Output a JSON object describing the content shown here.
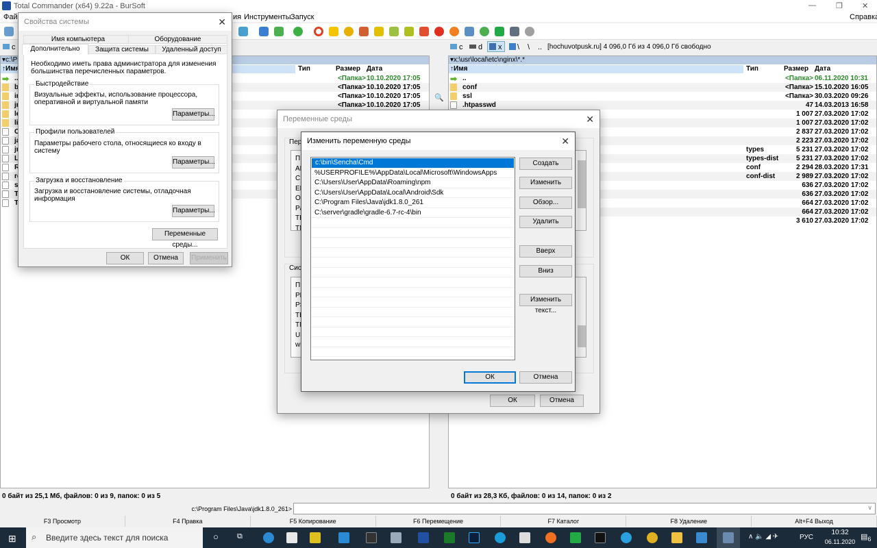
{
  "window": {
    "title": "Total Commander (x64) 9.22a - BurSoft",
    "min": "—",
    "max": "❐",
    "close": "✕"
  },
  "menu": {
    "file": "Фай",
    "frag": "ия",
    "tools": "Инструменты",
    "launch": "Запуск",
    "help": "Справка"
  },
  "left": {
    "drive": "c",
    "path": "▾c:\\Pr",
    "col_name": "↑Имя",
    "col_type": "Тип",
    "col_size": "Размер",
    "col_date": "Дата",
    "rows": [
      {
        "n": "..",
        "t": "",
        "s": "<Папка>",
        "d": "10.10.2020 17:05",
        "i": "up"
      },
      {
        "n": "bi",
        "t": "",
        "s": "<Папка>",
        "d": "10.10.2020 17:05",
        "i": "folder"
      },
      {
        "n": "in",
        "t": "",
        "s": "<Папка>",
        "d": "10.10.2020 17:05",
        "i": "folder"
      },
      {
        "n": "jr",
        "t": "",
        "s": "<Папка>",
        "d": "10.10.2020 17:05",
        "i": "folder"
      },
      {
        "n": "le",
        "t": "",
        "s": "",
        "d": "",
        "i": "folder"
      },
      {
        "n": "lib",
        "t": "",
        "s": "",
        "d": "",
        "i": "folder"
      },
      {
        "n": "CO",
        "t": "",
        "s": "",
        "d": "",
        "i": "file"
      },
      {
        "n": "ja",
        "t": "",
        "s": "",
        "d": "",
        "i": "file"
      },
      {
        "n": "jm",
        "t": "",
        "s": "",
        "d": "",
        "i": "file"
      },
      {
        "n": "LI",
        "t": "",
        "s": "",
        "d": "",
        "i": "file"
      },
      {
        "n": "RE",
        "t": "",
        "s": "",
        "d": "",
        "i": "file"
      },
      {
        "n": "re",
        "t": "",
        "s": "",
        "d": "",
        "i": "file"
      },
      {
        "n": "sn",
        "t": "",
        "s": "",
        "d": "",
        "i": "file"
      },
      {
        "n": "TH",
        "t": "",
        "s": "",
        "d": "",
        "i": "file"
      },
      {
        "n": "TH",
        "t": "",
        "s": "",
        "d": "",
        "i": "file"
      }
    ],
    "status": "0 байт из 25,1 Мб, файлов: 0 из 9, папок: 0 из 5"
  },
  "right": {
    "drives": [
      "c",
      "d",
      "x",
      "\\",
      "\\",
      ".."
    ],
    "free": "[hochuvotpusk.ru]  4 096,0 Гб из 4 096,0 Гб свободно",
    "path": "▾x:\\usr\\local\\etc\\nginx\\*.*",
    "col_name": "↑Имя",
    "col_type": "Тип",
    "col_size": "Размер",
    "col_date": "Дата",
    "rows": [
      {
        "n": "..",
        "t": "",
        "s": "<Папка>",
        "d": "06.11.2020 10:31",
        "i": "up"
      },
      {
        "n": "conf",
        "t": "",
        "s": "<Папка>",
        "d": "15.10.2020 16:05",
        "i": "folder"
      },
      {
        "n": "ssl",
        "t": "",
        "s": "<Папка>",
        "d": "30.03.2020 09:26",
        "i": "folder"
      },
      {
        "n": ".htpasswd",
        "t": "",
        "s": "47",
        "d": "14.03.2013 16:58",
        "i": "file"
      },
      {
        "n": "",
        "t": "",
        "s": "1 007",
        "d": "27.03.2020 17:02",
        "i": "file"
      },
      {
        "n": "",
        "t": "",
        "s": "1 007",
        "d": "27.03.2020 17:02",
        "i": "file"
      },
      {
        "n": "",
        "t": "",
        "s": "2 837",
        "d": "27.03.2020 17:02",
        "i": "file"
      },
      {
        "n": "",
        "t": "",
        "s": "2 223",
        "d": "27.03.2020 17:02",
        "i": "file"
      },
      {
        "n": "",
        "t": "types",
        "s": "5 231",
        "d": "27.03.2020 17:02",
        "i": "file"
      },
      {
        "n": "",
        "t": "types-dist",
        "s": "5 231",
        "d": "27.03.2020 17:02",
        "i": "file"
      },
      {
        "n": "",
        "t": "conf",
        "s": "2 294",
        "d": "28.03.2020 17:31",
        "i": "file"
      },
      {
        "n": "",
        "t": "conf-dist",
        "s": "2 989",
        "d": "27.03.2020 17:02",
        "i": "file"
      },
      {
        "n": "",
        "t": "",
        "s": "636",
        "d": "27.03.2020 17:02",
        "i": "file"
      },
      {
        "n": "",
        "t": "",
        "s": "636",
        "d": "27.03.2020 17:02",
        "i": "file"
      },
      {
        "n": "",
        "t": "",
        "s": "664",
        "d": "27.03.2020 17:02",
        "i": "file"
      },
      {
        "n": "",
        "t": "",
        "s": "664",
        "d": "27.03.2020 17:02",
        "i": "file"
      },
      {
        "n": "",
        "t": "",
        "s": "3 610",
        "d": "27.03.2020 17:02",
        "i": "file"
      }
    ],
    "status": "0 байт из 28,3 Кб, файлов: 0 из 14, папок: 0 из 2"
  },
  "cmdline": {
    "prompt": "c:\\Program Files\\Java\\jdk1.8.0_261>",
    "value": ""
  },
  "fkeys": [
    "F3 Просмотр",
    "F4 Правка",
    "F5 Копирование",
    "F6 Перемещение",
    "F7 Каталог",
    "F8 Удаление",
    "Alt+F4 Выход"
  ],
  "sysprops": {
    "title": "Свойства системы",
    "tabs": [
      "Имя компьютера",
      "Оборудование",
      "Дополнительно",
      "Защита системы",
      "Удаленный доступ"
    ],
    "notice": "Необходимо иметь права администратора для изменения большинства перечисленных параметров.",
    "perf_label": "Быстродействие",
    "perf_text": "Визуальные эффекты, использование процессора, оперативной и виртуальной памяти",
    "prof_label": "Профили пользователей",
    "prof_text": "Параметры рабочего стола, относящиеся ко входу в систему",
    "boot_label": "Загрузка и восстановление",
    "boot_text": "Загрузка и восстановление системы, отладочная информация",
    "params": "Параметры...",
    "envvars": "Переменные среды...",
    "ok": "ОК",
    "cancel": "Отмена",
    "apply": "Применить"
  },
  "envvars": {
    "title": "Переменные среды",
    "user_label": "Пере",
    "user_items": [
      "П",
      "AN",
      "CH",
      "EM",
      "On",
      "Pa",
      "TE",
      "TN"
    ],
    "sys_label": "Сист",
    "sys_items": [
      "П",
      "PR",
      "PS",
      "TE",
      "TN",
      "US",
      "wi"
    ],
    "ok": "ОК",
    "cancel": "Отмена"
  },
  "editenv": {
    "title": "Изменить переменную среды",
    "items": [
      "c:\\bin\\Sencha\\Cmd",
      "%USERPROFILE%\\AppData\\Local\\Microsoft\\WindowsApps",
      "C:\\Users\\User\\AppData\\Roaming\\npm",
      "C:\\Users\\User\\AppData\\Local\\Android\\Sdk",
      "C:\\Program Files\\Java\\jdk1.8.0_261",
      "C:\\server\\gradle\\gradle-6.7-rc-4\\bin"
    ],
    "selected": 0,
    "create": "Создать",
    "edit": "Изменить",
    "browse": "Обзор...",
    "delete": "Удалить",
    "up": "Вверх",
    "down": "Вниз",
    "edit_text": "Изменить текст...",
    "ok": "ОК",
    "cancel": "Отмена"
  },
  "taskbar": {
    "search": "Введите здесь текст для поиска",
    "lang": "РУС",
    "time": "10:32",
    "date": "06.11.2020",
    "notif": "6"
  },
  "colors": {
    "accent": "#0078d7",
    "pathbar": "#b8cce4",
    "taskbar": "#1c2b3a",
    "green": "#2a8a2a"
  }
}
